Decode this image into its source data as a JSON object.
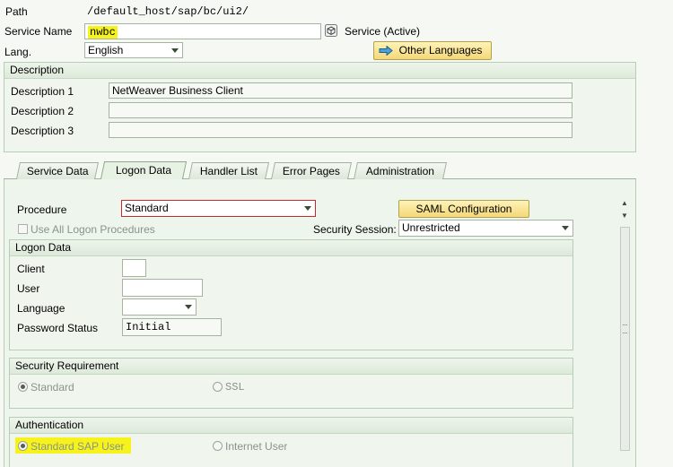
{
  "header": {
    "path_label": "Path",
    "path_value": "/default_host/sap/bc/ui2/",
    "service_name_label": "Service Name",
    "service_name_value": "nwbc",
    "service_status": "Service (Active)",
    "lang_label": "Lang.",
    "lang_value": "English",
    "other_languages_button": "Other Languages"
  },
  "description": {
    "title": "Description",
    "rows": [
      {
        "label": "Description 1",
        "value": "NetWeaver Business Client"
      },
      {
        "label": "Description 2",
        "value": ""
      },
      {
        "label": "Description 3",
        "value": ""
      }
    ]
  },
  "tabs": [
    "Service Data",
    "Logon Data",
    "Handler List",
    "Error Pages",
    "Administration"
  ],
  "active_tab": "Logon Data",
  "logon": {
    "procedure_label": "Procedure",
    "procedure_value": "Standard",
    "saml_button": "SAML Configuration",
    "use_all_label": "Use All Logon Procedures",
    "security_session_label": "Security Session:",
    "security_session_value": "Unrestricted",
    "logon_data_group": {
      "title": "Logon Data",
      "client_label": "Client",
      "client_value": "",
      "user_label": "User",
      "user_value": "",
      "language_label": "Language",
      "language_value": "",
      "password_status_label": "Password Status",
      "password_status_value": "Initial"
    },
    "security_requirement": {
      "title": "Security Requirement",
      "options": [
        "Standard",
        "SSL"
      ],
      "selected": "Standard"
    },
    "authentication": {
      "title": "Authentication",
      "options": [
        "Standard SAP User",
        "Internet User"
      ],
      "selected": "Standard SAP User"
    }
  },
  "colors": {
    "highlight": "#f6f21b",
    "button": "#f4d878",
    "group_background": "#f0f6ee"
  },
  "icons": [
    "service-status-icon",
    "arrow-right-icon",
    "dropdown-arrow-icon",
    "scroll-up-icon",
    "scroll-down-icon",
    "scroll-grip-icon"
  ]
}
